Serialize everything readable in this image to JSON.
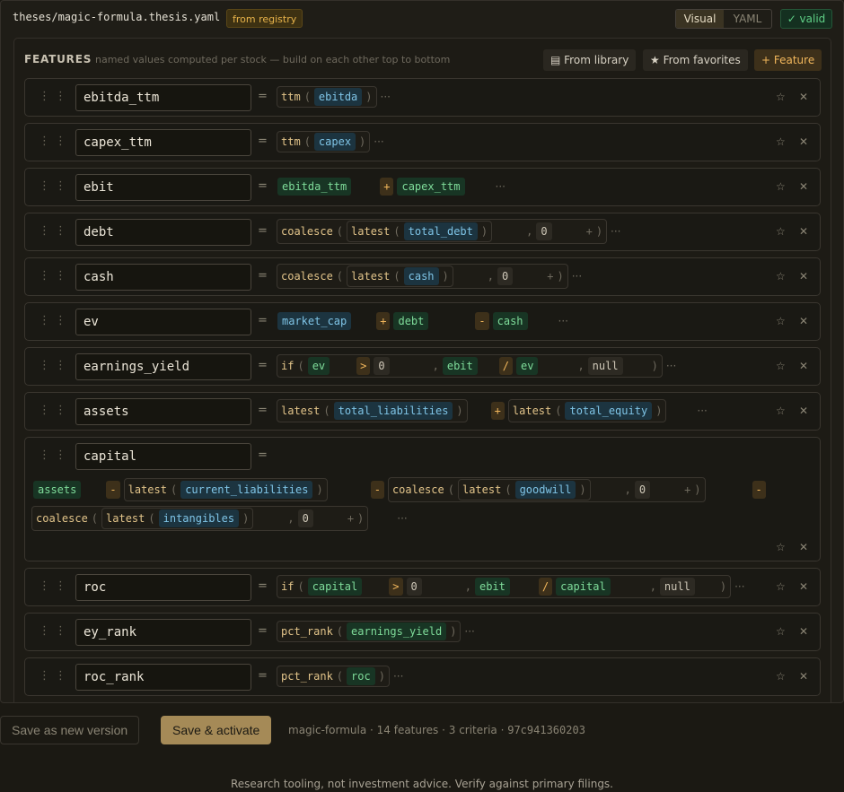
{
  "header": {
    "file_path": "theses/magic-formula.thesis.yaml",
    "registry_badge": "from registry",
    "view_visual": "Visual",
    "view_yaml": "YAML",
    "valid_badge": "✓ valid"
  },
  "features_section": {
    "title": "FEATURES",
    "subtitle": "named values computed per stock — build on each other top to bottom",
    "from_library": "▤ From library",
    "from_favorites": "★ From favorites",
    "add_feature": "+ Feature"
  },
  "tokens": {
    "eq": "=",
    "open": "(",
    "close": ")",
    "comma": ",",
    "more": "···",
    "plus": "+",
    "star": "☆",
    "remove": "✕",
    "drag": "⋮⋮",
    "op_plus": "+",
    "op_minus": "-",
    "op_gt": ">",
    "op_div": "/"
  },
  "features": [
    {
      "name": "ebitda_ttm",
      "fn": "ttm",
      "arg": "ebitda"
    },
    {
      "name": "capex_ttm",
      "fn": "ttm",
      "arg": "capex"
    },
    {
      "name": "ebit",
      "left": "ebitda_ttm",
      "right": "capex_ttm"
    },
    {
      "name": "debt",
      "fn": "coalesce",
      "inner_fn": "latest",
      "arg": "total_debt",
      "default": "0"
    },
    {
      "name": "cash",
      "fn": "coalesce",
      "inner_fn": "latest",
      "arg": "cash",
      "default": "0"
    },
    {
      "name": "ev",
      "a": "market_cap",
      "b": "debt",
      "c": "cash"
    },
    {
      "name": "earnings_yield",
      "fn": "if",
      "cond_left": "ev",
      "cond_right": "0",
      "num": "ebit",
      "den": "ev",
      "else": "null"
    },
    {
      "name": "assets",
      "fn": "latest",
      "arg1": "total_liabilities",
      "arg2": "total_equity"
    },
    {
      "name": "capital",
      "base": "assets",
      "fn": "latest",
      "arg1": "current_liabilities",
      "coalesce": "coalesce",
      "arg2": "goodwill",
      "default1": "0",
      "arg3": "intangibles",
      "default2": "0"
    },
    {
      "name": "roc",
      "fn": "if",
      "cond_left": "capital",
      "cond_right": "0",
      "num": "ebit",
      "den": "capital",
      "else": "null"
    },
    {
      "name": "ey_rank",
      "fn": "pct_rank",
      "arg": "earnings_yield"
    },
    {
      "name": "roc_rank",
      "fn": "pct_rank",
      "arg": "roc"
    }
  ],
  "footer_bar": {
    "save_new_version": "Save as new version",
    "save_activate": "Save & activate",
    "meta_prefix": "magic-formula · 14 features · 3 criteria · ",
    "hash": "97c941360203"
  },
  "disclaimer": "Research tooling, not investment advice. Verify against primary filings.",
  "colors": {
    "background": "#1b1913",
    "accent": "#f2b75c",
    "field_chip": "#7fc4e6",
    "ref_chip": "#7fdc9a",
    "valid": "#5fcf86",
    "primary_button": "#a58a57"
  }
}
